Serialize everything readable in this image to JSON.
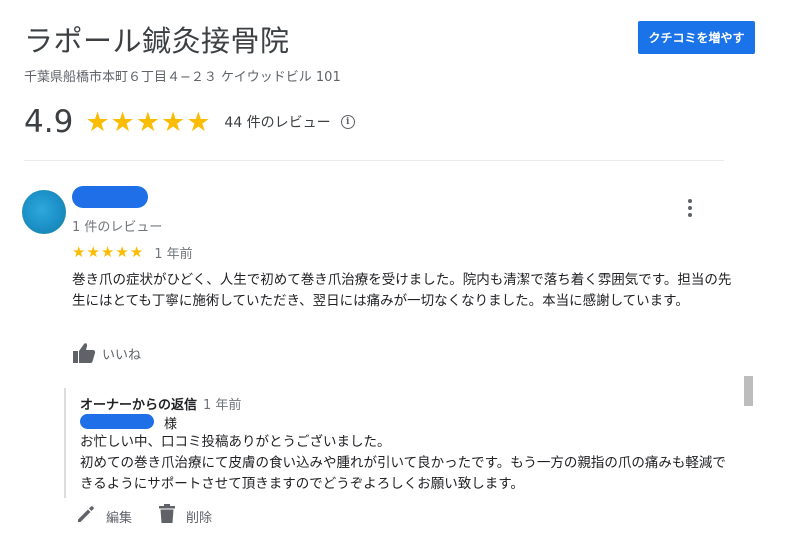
{
  "business": {
    "name": "ラポール鍼灸接骨院",
    "address": "千葉県船橋市本町６丁目４−２３ ケイウッドビル 101",
    "cta_label": "クチコミを増やす"
  },
  "summary": {
    "rating": "4.9",
    "stars": [
      "★",
      "★",
      "★",
      "★",
      "★"
    ],
    "review_count": "44 件のレビュー",
    "info_glyph": "i"
  },
  "review": {
    "reviewer_meta": "1 件のレビュー",
    "stars": [
      "★",
      "★",
      "★",
      "★",
      "★"
    ],
    "date": "1 年前",
    "text": "巻き爪の症状がひどく、人生で初めて巻き爪治療を受けました。院内も清潔で落ち着く雰囲気です。担当の先生にはとても丁寧に施術していただき、翌日には痛みが一切なくなりました。本当に感謝しています。",
    "like_label": "いいね"
  },
  "owner_reply": {
    "title": "オーナーからの返信",
    "date": "1 年前",
    "honorific": "様",
    "line1": "お忙しい中、口コミ投稿ありがとうございました。",
    "line2": "初めての巻き爪治療にて皮膚の食い込みや腫れが引いて良かったです。もう一方の親指の爪の痛みも軽減できるようにサポートさせて頂きますのでどうぞよろしくお願い致します。",
    "edit_label": "編集",
    "delete_label": "削除"
  },
  "colors": {
    "accent": "#1a73e8",
    "star": "#fbbc04",
    "avatar": "#1b8fc6"
  },
  "icons": {
    "info": "info-icon",
    "more": "more-vert-icon",
    "like": "thumb-up-icon",
    "edit": "pencil-icon",
    "delete": "trash-icon"
  }
}
